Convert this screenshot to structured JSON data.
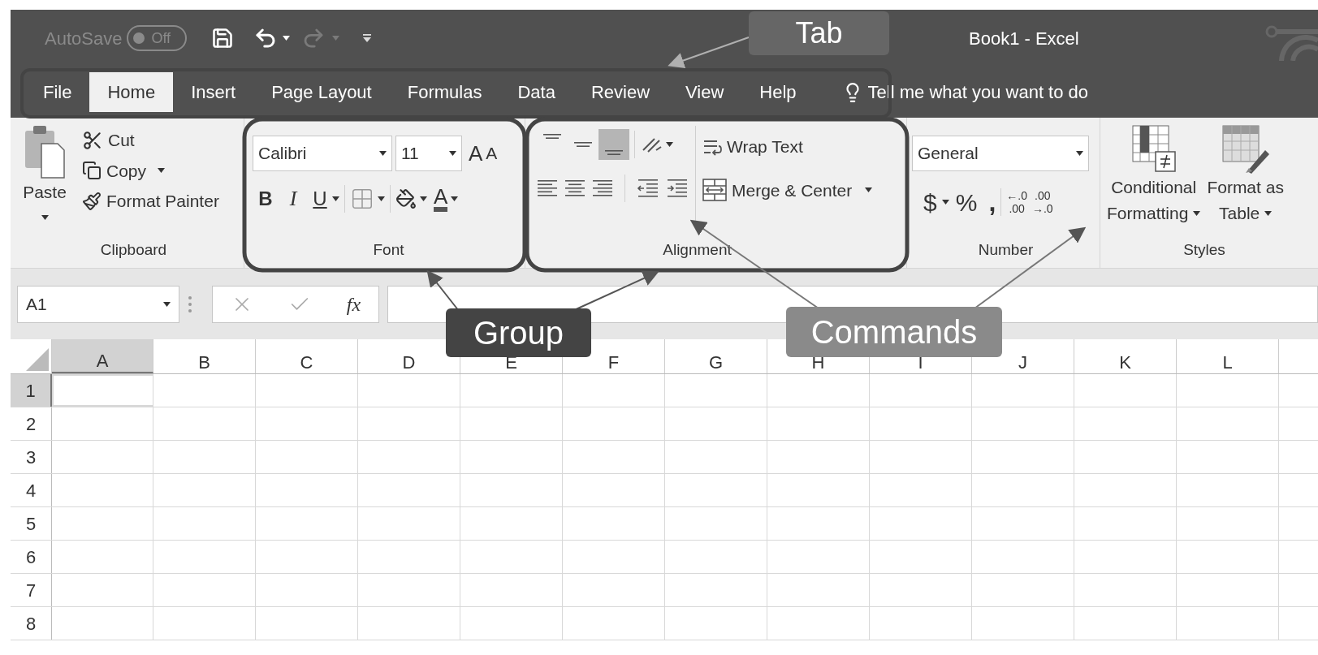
{
  "title_bar": {
    "autosave_label": "AutoSave",
    "autosave_state": "Off",
    "autosave_on": false,
    "title": "Book1  -  Excel"
  },
  "tabs": [
    {
      "label": "File",
      "selected": false
    },
    {
      "label": "Home",
      "selected": true
    },
    {
      "label": "Insert",
      "selected": false
    },
    {
      "label": "Page Layout",
      "selected": false
    },
    {
      "label": "Formulas",
      "selected": false
    },
    {
      "label": "Data",
      "selected": false
    },
    {
      "label": "Review",
      "selected": false
    },
    {
      "label": "View",
      "selected": false
    },
    {
      "label": "Help",
      "selected": false
    }
  ],
  "tell_me": {
    "placeholder": "Tell me what you want to do"
  },
  "ribbon": {
    "clipboard": {
      "label": "Clipboard",
      "paste": "Paste",
      "cut": "Cut",
      "copy": "Copy",
      "format_painter": "Format Painter"
    },
    "font": {
      "label": "Font",
      "font_name": "Calibri",
      "font_size": "11",
      "grow": "A",
      "shrink": "A",
      "bold": "B",
      "italic": "I",
      "underline": "U",
      "font_color": "A"
    },
    "alignment": {
      "label": "Alignment",
      "wrap_text": "Wrap Text",
      "merge_center": "Merge & Center",
      "bottom_align_selected": true
    },
    "number": {
      "label": "Number",
      "format": "General",
      "currency": "$",
      "percent": "%",
      "comma": ",",
      "increase_decimal": [
        "←.0",
        ".00"
      ],
      "decrease_decimal": [
        ".00",
        "→.0"
      ]
    },
    "styles": {
      "label": "Styles",
      "conditional": [
        "Conditional",
        "Formatting"
      ],
      "format_table": [
        "Format as",
        "Table"
      ]
    }
  },
  "formula_bar": {
    "name_box": "A1",
    "function_label": "fx"
  },
  "sheet": {
    "columns": [
      {
        "label": "A",
        "selected": true
      },
      {
        "label": "B",
        "selected": false
      },
      {
        "label": "C",
        "selected": false
      },
      {
        "label": "D",
        "selected": false
      },
      {
        "label": "E",
        "selected": false
      },
      {
        "label": "F",
        "selected": false
      },
      {
        "label": "G",
        "selected": false
      },
      {
        "label": "H",
        "selected": false
      },
      {
        "label": "I",
        "selected": false
      },
      {
        "label": "J",
        "selected": false
      },
      {
        "label": "K",
        "selected": false
      },
      {
        "label": "L",
        "selected": false
      }
    ],
    "rows": [
      {
        "label": "1",
        "selected": true
      },
      {
        "label": "2",
        "selected": false
      },
      {
        "label": "3",
        "selected": false
      },
      {
        "label": "4",
        "selected": false
      },
      {
        "label": "5",
        "selected": false
      },
      {
        "label": "6",
        "selected": false
      },
      {
        "label": "7",
        "selected": false
      },
      {
        "label": "8",
        "selected": false
      }
    ]
  },
  "annotations": [
    {
      "label": "Tab"
    },
    {
      "label": "Group"
    },
    {
      "label": "Commands"
    }
  ]
}
